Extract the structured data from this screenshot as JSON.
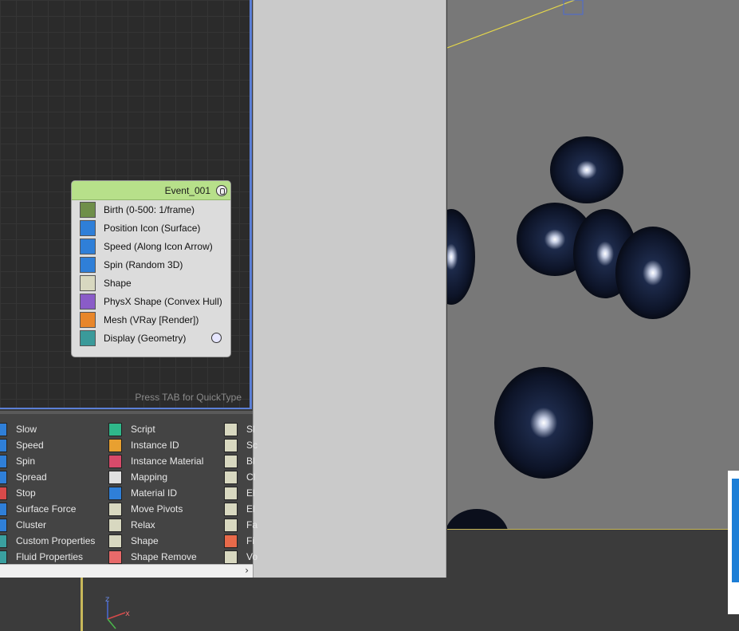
{
  "graph": {
    "quicktype_hint": "Press TAB for QuickType"
  },
  "event": {
    "title": "Event_001",
    "operators": [
      {
        "label": "Birth (0-500: 1/frame)",
        "icon": "birth-icon",
        "color": "#6f8f4a"
      },
      {
        "label": "Position Icon (Surface)",
        "icon": "position-icon",
        "color": "#2f7fd8"
      },
      {
        "label": "Speed (Along Icon Arrow)",
        "icon": "speed-icon",
        "color": "#2f7fd8"
      },
      {
        "label": "Spin (Random 3D)",
        "icon": "spin-icon",
        "color": "#2f7fd8"
      },
      {
        "label": "Shape",
        "icon": "shape-icon",
        "color": "#d8d8c0"
      },
      {
        "label": "PhysX Shape (Convex Hull)",
        "icon": "physx-shape-icon",
        "color": "#8a5cc8"
      },
      {
        "label": "Mesh (VRay [Render])",
        "icon": "mesh-icon",
        "color": "#e8862a"
      },
      {
        "label": "Display (Geometry)",
        "icon": "display-icon",
        "color": "#3a9a9a"
      }
    ]
  },
  "depot": {
    "col1": [
      "Slow",
      "Speed",
      "Spin",
      "Spread",
      "Stop",
      "Surface Force",
      "Cluster",
      "Custom Properties",
      "Fluid Properties"
    ],
    "col2": [
      "Script",
      "Instance ID",
      "Instance Material",
      "Mapping",
      "Material ID",
      "Move Pivots",
      "Relax",
      "Shape",
      "Shape Remove"
    ],
    "col3": [
      "Sl",
      "Sc",
      "Bl",
      "Cl",
      "El",
      "El",
      "Fa",
      "Fi",
      "Vo"
    ],
    "col1_colors": [
      "#2f7fd8",
      "#2f7fd8",
      "#2f7fd8",
      "#2f7fd8",
      "#d84a4a",
      "#2f7fd8",
      "#2f7fd8",
      "#3aa0a0",
      "#3aa0a0"
    ],
    "col2_colors": [
      "#2fb88a",
      "#e8a030",
      "#d84a6a",
      "#e0e0e0",
      "#2f7fd8",
      "#d8d8c0",
      "#d8d8c0",
      "#d8d8c0",
      "#e86a6a"
    ],
    "col3_colors": [
      "#d8d8c0",
      "#d8d8c0",
      "#d8d8c0",
      "#d8d8c0",
      "#d8d8c0",
      "#d8d8c0",
      "#d8d8c0",
      "#e86a4a",
      "#d8d8c0"
    ],
    "scroll_arrow": "›"
  },
  "viewport": {
    "axis_labels": {
      "z": "z",
      "x": "x"
    }
  }
}
